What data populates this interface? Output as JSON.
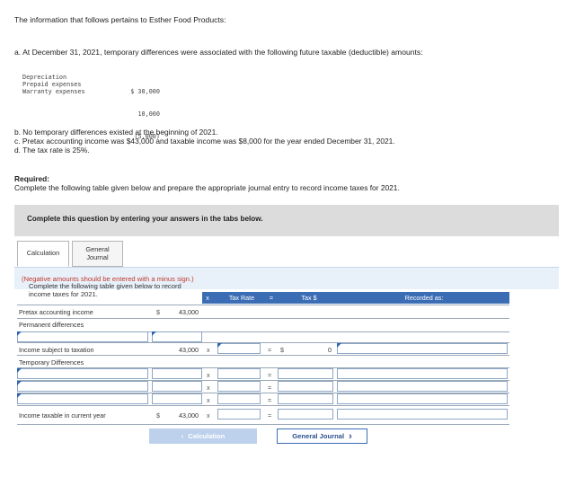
{
  "intro": "The information that follows pertains to Esther Food Products:",
  "part_a": "a. At December 31, 2021, temporary differences were associated with the following future taxable (deductible) amounts:",
  "differences": [
    {
      "label": "Depreciation",
      "amount": "$ 30,000"
    },
    {
      "label": "Prepaid expenses",
      "amount": "10,000"
    },
    {
      "label": "Warranty expenses",
      "amount": "(5,000)"
    }
  ],
  "part_b": "b. No temporary differences existed at the beginning of 2021.",
  "part_c": "c. Pretax accounting income was $43,000 and taxable income was $8,000 for the year ended December 31, 2021.",
  "part_d": "d. The tax rate is 25%.",
  "required_heading": "Required:",
  "required_text": "Complete the following table given below and prepare the appropriate journal entry to record income taxes for 2021.",
  "banner": "Complete this question by entering your answers in the tabs below.",
  "tabs": {
    "calculation": "Calculation",
    "general_journal_1": "General",
    "general_journal_2": "Journal"
  },
  "instruction": "Complete the following table given below to record income taxes for 2021.",
  "instruction_note": "(Negative amounts should be entered with a minus sign.)",
  "table_header": {
    "x": "x",
    "tax_rate": "Tax Rate",
    "eq": "=",
    "tax": "Tax $",
    "recorded": "Recorded as:"
  },
  "rows": {
    "pretax_label": "Pretax accounting income",
    "pretax_dollar": "$",
    "pretax_value": "43,000",
    "permanent_label": "Permanent differences",
    "subject_label": "Income subject to taxation",
    "subject_value": "43,000",
    "subject_x": "x",
    "subject_eq": "=",
    "subject_dollar": "$",
    "subject_tax": "0",
    "temporary_label": "Temporary Differences",
    "temp_x": "x",
    "temp_eq": "=",
    "current_label": "Income taxable in current year",
    "current_dollar": "$",
    "current_value": "43,000",
    "current_x": "x",
    "current_eq": "="
  },
  "buttons": {
    "prev": "Calculation",
    "prev_icon": "‹",
    "next": "General Journal",
    "next_icon": "›"
  }
}
